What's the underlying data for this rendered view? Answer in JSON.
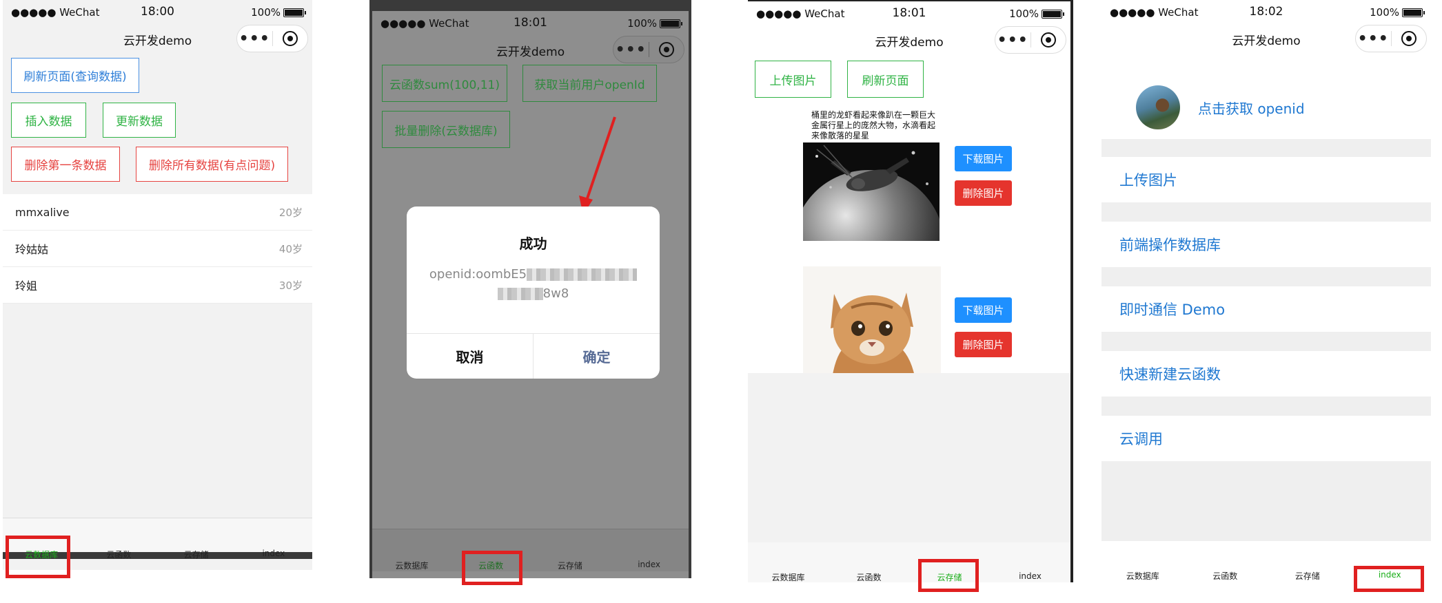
{
  "status": {
    "carrier": "●●●●● WeChat",
    "battery": "100%",
    "times": [
      "18:00",
      "18:01",
      "18:01",
      "18:02"
    ]
  },
  "navbar": {
    "title": "云开发demo",
    "more": "•••"
  },
  "tabs": [
    "云数据库",
    "云函数",
    "云存储",
    "index"
  ],
  "screen1": {
    "buttons": {
      "refresh": "刷新页面(查询数据)",
      "insert": "插入数据",
      "update": "更新数据",
      "delete_first": "删除第一条数据",
      "delete_all": "删除所有数据(有点问题)"
    },
    "rows": [
      {
        "name": "mmxalive",
        "age": "20岁"
      },
      {
        "name": "玲姑姑",
        "age": "40岁"
      },
      {
        "name": "玲姐",
        "age": "30岁"
      }
    ]
  },
  "screen2": {
    "buttons": {
      "sum": "云函数sum(100,11)",
      "openid": "获取当前用户openId",
      "batch_delete": "批量删除(云数据库)"
    },
    "dialog": {
      "title": "成功",
      "prefix": "openid:oombE5",
      "suffix": "8w8",
      "cancel": "取消",
      "confirm": "确定"
    }
  },
  "screen3": {
    "buttons": {
      "upload": "上传图片",
      "refresh": "刷新页面"
    },
    "caption": "桶里的龙虾看起来像趴在一颗巨大金属行星上的庞然大物，水滴看起来像散落的星星",
    "download": "下载图片",
    "delete": "删除图片"
  },
  "screen4": {
    "get_openid": "点击获取 openid",
    "menu": [
      "上传图片",
      "前端操作数据库",
      "即时通信 Demo",
      "快速新建云函数",
      "云调用"
    ]
  },
  "colors": {
    "highlight": "#e02020",
    "active_tab": "#1aad19",
    "link": "#1f78d1"
  }
}
